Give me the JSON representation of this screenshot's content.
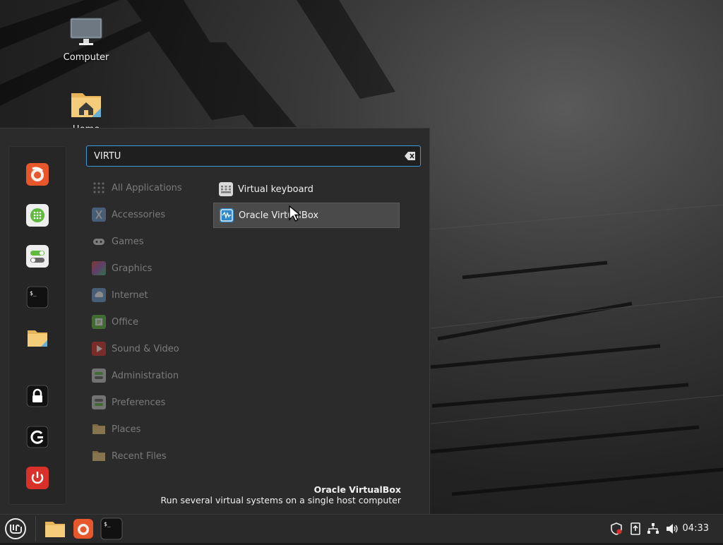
{
  "desktop": {
    "icons": [
      {
        "label": "Computer",
        "icon": "computer-icon"
      },
      {
        "label": "Home",
        "icon": "home-folder-icon"
      }
    ]
  },
  "menu": {
    "search": {
      "value": "VIRTU"
    },
    "favorites": [
      {
        "name": "Firefox",
        "icon": "firefox-icon"
      },
      {
        "name": "Software Manager",
        "icon": "software-manager-icon"
      },
      {
        "name": "System Settings",
        "icon": "settings-icon"
      },
      {
        "name": "Terminal",
        "icon": "terminal-icon"
      },
      {
        "name": "Files",
        "icon": "folder-icon"
      },
      {
        "name": "Lock Screen",
        "icon": "lock-icon"
      },
      {
        "name": "Log Out",
        "icon": "logout-icon"
      },
      {
        "name": "Quit",
        "icon": "power-icon"
      }
    ],
    "categories": [
      "All Applications",
      "Accessories",
      "Games",
      "Graphics",
      "Internet",
      "Office",
      "Sound & Video",
      "Administration",
      "Preferences",
      "Places",
      "Recent Files"
    ],
    "results": [
      {
        "label": "Virtual keyboard",
        "icon": "keyboard-icon",
        "selected": false
      },
      {
        "label": "Oracle VirtualBox",
        "icon": "virtualbox-icon",
        "selected": true
      }
    ],
    "description": {
      "title": "Oracle VirtualBox",
      "text": "Run several virtual systems on a single host computer"
    }
  },
  "panel": {
    "clock": "04:33",
    "launchers": [
      "folder-icon",
      "firefox-icon",
      "terminal-icon"
    ],
    "tray": [
      "shield-icon",
      "update-icon",
      "network-icon",
      "volume-icon"
    ]
  },
  "colors": {
    "accent": "#3a9bd8",
    "menu_bg": "#2b2b2b",
    "panel_bg": "#2a2a2a"
  }
}
